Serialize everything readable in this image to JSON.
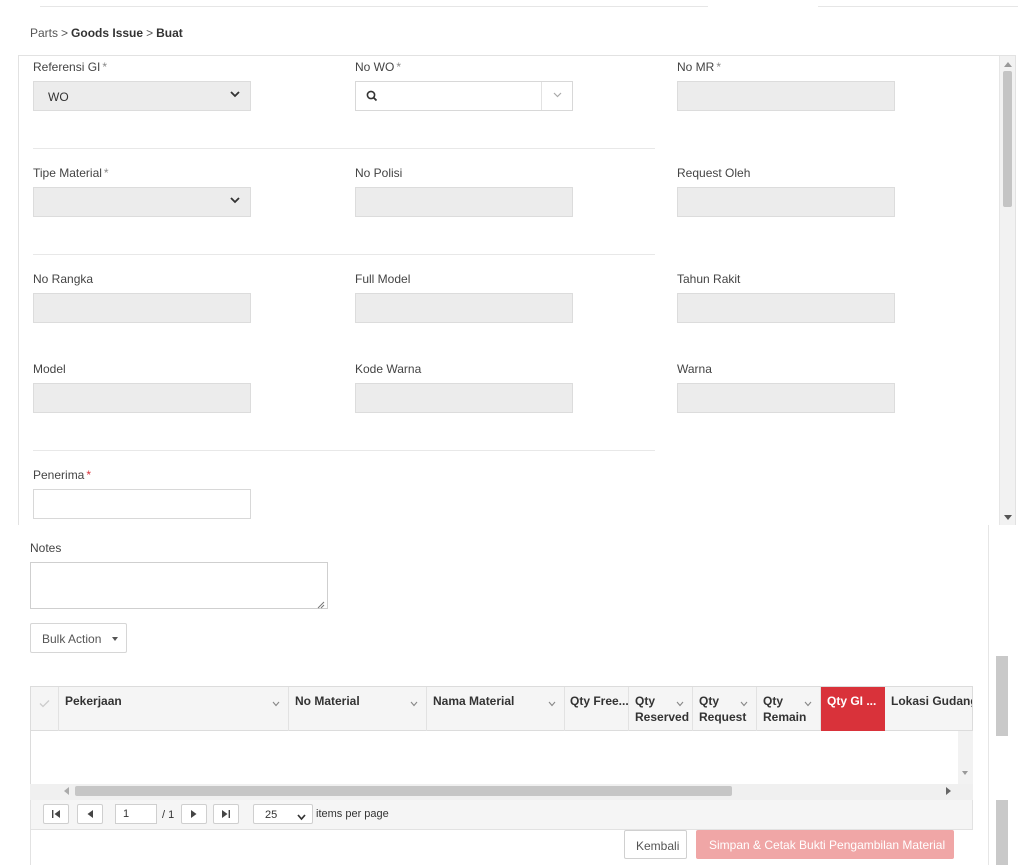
{
  "breadcrumb": [
    "Parts",
    "Goods Issue",
    "Buat"
  ],
  "breadcrumb_sep": ">",
  "required_mark": "*",
  "form": {
    "referensi_gi": {
      "label": "Referensi GI",
      "value": "WO"
    },
    "no_wo": {
      "label": "No WO",
      "value": ""
    },
    "no_mr": {
      "label": "No MR"
    },
    "tipe_material": {
      "label": "Tipe Material"
    },
    "no_polisi": {
      "label": "No Polisi"
    },
    "request_oleh": {
      "label": "Request Oleh"
    },
    "no_rangka": {
      "label": "No Rangka"
    },
    "full_model": {
      "label": "Full Model"
    },
    "tahun_rakit": {
      "label": "Tahun Rakit"
    },
    "model": {
      "label": "Model"
    },
    "kode_warna": {
      "label": "Kode Warna"
    },
    "warna": {
      "label": "Warna"
    },
    "penerima": {
      "label": "Penerima"
    }
  },
  "notes": {
    "label": "Notes"
  },
  "bulk_action": {
    "label": "Bulk Action"
  },
  "grid": {
    "columns": [
      {
        "line1": "Pekerjaan",
        "line2": ""
      },
      {
        "line1": "No Material",
        "line2": ""
      },
      {
        "line1": "Nama Material",
        "line2": ""
      },
      {
        "line1": "Qty Free...",
        "line2": ""
      },
      {
        "line1": "Qty",
        "line2": "Reserved"
      },
      {
        "line1": "Qty",
        "line2": "Request"
      },
      {
        "line1": "Qty",
        "line2": "Remain"
      },
      {
        "line1": "Qty GI ...",
        "line2": ""
      },
      {
        "line1": "Lokasi Gudang",
        "line2": ""
      }
    ]
  },
  "pager": {
    "page": "1",
    "of_label": "/",
    "total_pages": "1",
    "page_size": "25",
    "items_per_page_label": "items per page"
  },
  "actions": {
    "back_label": "Kembali",
    "save_label": "Simpan & Cetak Bukti Pengambilan Material"
  },
  "colors": {
    "accent_red": "#d9323a",
    "save_disabled": "#f0a6a6"
  }
}
